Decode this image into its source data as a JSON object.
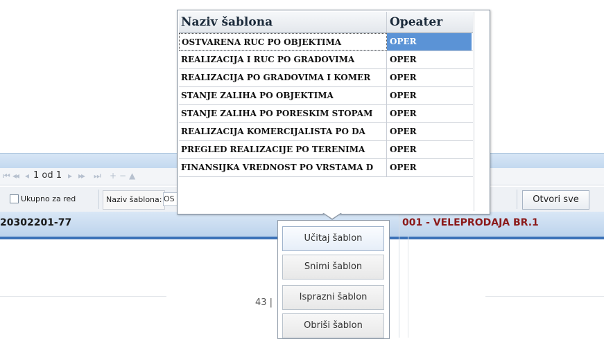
{
  "pager": {
    "page_text": "1 od 1"
  },
  "toolbar": {
    "total_per_row_label": "Ukupno za red",
    "template_name_label": "Naziv šablona:",
    "template_name_value": "OS",
    "open_all_label": "Otvori sve"
  },
  "document_header": {
    "document_number": "20302201-77",
    "store": "001 - VELEPRODAJA BR.1"
  },
  "page_number_text": "43 |",
  "template_grid": {
    "columns": [
      "Naziv šablona",
      "Opeater"
    ],
    "rows": [
      {
        "name": "OSTVARENA RUC PO OBJEKTIMA",
        "operator": "OPER"
      },
      {
        "name": "REALIZACIJA I RUC PO GRADOVIMA",
        "operator": "OPER"
      },
      {
        "name": "REALIZACIJA PO GRADOVIMA I KOMER",
        "operator": "OPER"
      },
      {
        "name": "STANJE ZALIHA PO OBJEKTIMA",
        "operator": "OPER"
      },
      {
        "name": "STANJE ZALIHA PO PORESKIM STOPAM",
        "operator": "OPER"
      },
      {
        "name": "REALIZACIJA KOMERCIJALISTA PO DA",
        "operator": "OPER"
      },
      {
        "name": "PREGLED REALIZACIJE PO TERENIMA",
        "operator": "OPER"
      },
      {
        "name": "FINANSIJKA VREDNOST PO VRSTAMA D",
        "operator": "OPER"
      }
    ],
    "selected_index": 0
  },
  "template_menu": {
    "load": "Učitaj šablon",
    "save": "Snimi šablon",
    "clear": "Isprazni šablon",
    "delete": "Obriši šablon"
  },
  "colors": {
    "selection": "#5b93d6",
    "header_band": "#bcd3ec",
    "store_text": "#8b1a1a"
  }
}
